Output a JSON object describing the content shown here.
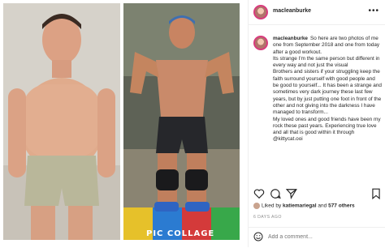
{
  "post": {
    "username": "macleanburke",
    "more_label": "•••",
    "caption_paragraphs": [
      "So here are two photos of me one from September 2018 and one from today after a good workout.",
      "Its strange I'm the same person but different in every way and not just the visual",
      "Brothers and sisters if your struggling keep the faith surround yourself with good people and be good to yourself... It has been a strange and sometimes very dark journey these last few years, but by just putting one foot in front of the other and not giving into the darkness I have managed to transform...",
      "My loved ones and good friends have been my rock these past years. Experiencing true love and all that is good within it through @kittycat.ooi"
    ],
    "likes": {
      "prefix": "Liked by",
      "user": "katiemariegal",
      "conjunction": "and",
      "count_label": "577 others"
    },
    "time_ago": "6 DAYS AGO",
    "comment_placeholder": "Add a comment...",
    "watermark": "PIC COLLAGE"
  },
  "icons": {
    "like": "heart-icon",
    "comment": "comment-icon",
    "share": "share-icon",
    "save": "bookmark-icon",
    "emoji": "smile-icon",
    "more": "more-icon"
  }
}
